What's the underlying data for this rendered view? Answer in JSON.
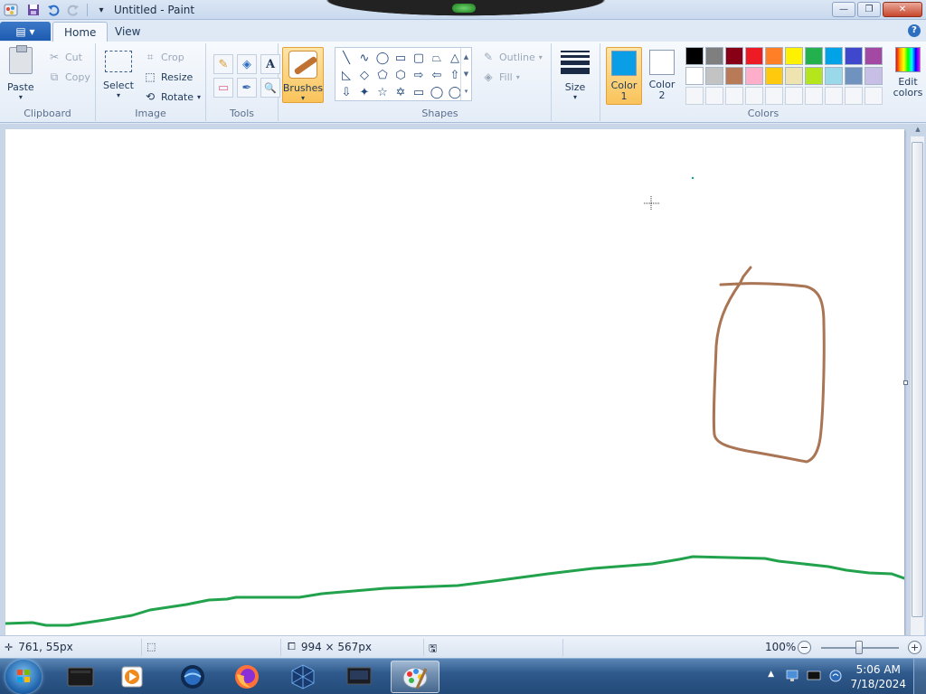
{
  "window": {
    "title": "Untitled - Paint",
    "controls": {
      "minimize": "—",
      "maximize": "❐",
      "close": "✕"
    }
  },
  "qat": {
    "save_icon": "save-icon",
    "undo_icon": "undo-icon",
    "redo_icon": "redo-icon",
    "customize_icon": "▾"
  },
  "tabs": {
    "file_menu": "▤ ▾",
    "home": "Home",
    "view": "View",
    "help": "?"
  },
  "ribbon": {
    "clipboard": {
      "label": "Clipboard",
      "paste": "Paste",
      "cut": "Cut",
      "copy": "Copy"
    },
    "image": {
      "label": "Image",
      "select": "Select",
      "crop": "Crop",
      "resize": "Resize",
      "rotate": "Rotate"
    },
    "tools": {
      "label": "Tools",
      "items": [
        "✎",
        "◈",
        "A",
        "▭",
        "✒",
        "🔍"
      ]
    },
    "brushes": {
      "label": "Brushes"
    },
    "shapes": {
      "label": "Shapes",
      "items": [
        "╲",
        "∿",
        "◯",
        "▭",
        "▢",
        "⏢",
        "△",
        "◺",
        "◇",
        "⬠",
        "⬡",
        "⇨",
        "⇦",
        "⇧",
        "⇩",
        "✦",
        "☆",
        "✡",
        "▭",
        "◯",
        "◯"
      ],
      "outline": "Outline",
      "fill": "Fill"
    },
    "size": {
      "label": "Size"
    },
    "colors": {
      "label": "Colors",
      "color1_label": "Color\n1",
      "color1": "#0a9ee6",
      "color2_label": "Color\n2",
      "color2": "#ffffff",
      "edit_colors": "Edit colors",
      "palette": [
        "#000000",
        "#7f7f7f",
        "#880015",
        "#ed1c24",
        "#ff7f27",
        "#fff200",
        "#22b14c",
        "#00a2e8",
        "#3f48cc",
        "#a349a4",
        "#ffffff",
        "#c3c3c3",
        "#b97a57",
        "#ffaec9",
        "#ffc90e",
        "#efe4b0",
        "#b5e61d",
        "#99d9ea",
        "#7092be",
        "#c8bfe7",
        "#f4f6f9",
        "#f4f6f9",
        "#f4f6f9",
        "#f4f6f9",
        "#f4f6f9",
        "#f4f6f9",
        "#f4f6f9",
        "#f4f6f9",
        "#f4f6f9",
        "#f4f6f9"
      ]
    }
  },
  "canvas": {
    "stroke_brown": "#a97554",
    "stroke_green": "#22a24c"
  },
  "status": {
    "cursor_pos": "761, 55px",
    "canvas_size": "994 × 567px",
    "zoom": "100%",
    "zoom_fraction": 0.5
  },
  "taskbar": {
    "apps": [
      "terminal-icon",
      "media-player-icon",
      "browser-icon",
      "firefox-icon",
      "virtualbox-icon",
      "monitor-app-icon",
      "paint-icon"
    ],
    "time": "5:06 AM",
    "date": "7/18/2024"
  }
}
